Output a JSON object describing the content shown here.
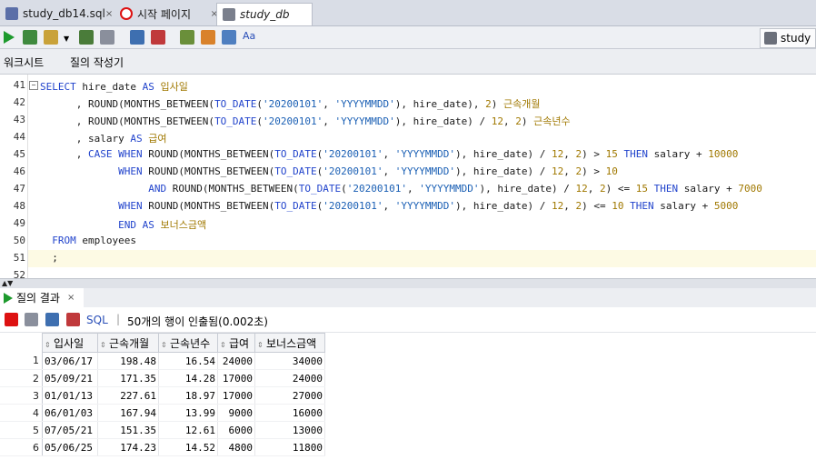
{
  "tabs": [
    {
      "label": "study_db14.sql",
      "close": "×"
    },
    {
      "label": "시작 페이지",
      "close": "×"
    },
    {
      "label": "study_db",
      "close": "×"
    }
  ],
  "connection": {
    "label": "study"
  },
  "subtabs": {
    "worksheet": "워크시트",
    "query_builder": "질의 작성기"
  },
  "editor": {
    "line_numbers": [
      "41",
      "42",
      "43",
      "44",
      "45",
      "46",
      "47",
      "48",
      "49",
      "50",
      "51",
      "52"
    ]
  },
  "results": {
    "tab_label": "질의 결과",
    "tab_close": "×",
    "sql_label": "SQL",
    "separator": "|",
    "status": "50개의 행이 인출됨(0.002초)",
    "columns": [
      "입사일",
      "근속개월",
      "근속년수",
      "급여",
      "보너스금액"
    ],
    "rows": [
      {
        "n": "1",
        "c1": "03/06/17",
        "c2": "198.48",
        "c3": "16.54",
        "c4": "24000",
        "c5": "34000"
      },
      {
        "n": "2",
        "c1": "05/09/21",
        "c2": "171.35",
        "c3": "14.28",
        "c4": "17000",
        "c5": "24000"
      },
      {
        "n": "3",
        "c1": "01/01/13",
        "c2": "227.61",
        "c3": "18.97",
        "c4": "17000",
        "c5": "27000"
      },
      {
        "n": "4",
        "c1": "06/01/03",
        "c2": "167.94",
        "c3": "13.99",
        "c4": "9000",
        "c5": "16000"
      },
      {
        "n": "5",
        "c1": "07/05/21",
        "c2": "151.35",
        "c3": "12.61",
        "c4": "6000",
        "c5": "13000"
      },
      {
        "n": "6",
        "c1": "05/06/25",
        "c2": "174.23",
        "c3": "14.52",
        "c4": "4800",
        "c5": "11800"
      }
    ]
  },
  "colors": {
    "keyword": "#2244cc",
    "string": "#1a5fb4",
    "alias": "#a07800",
    "run_green": "#1d9a2d"
  }
}
